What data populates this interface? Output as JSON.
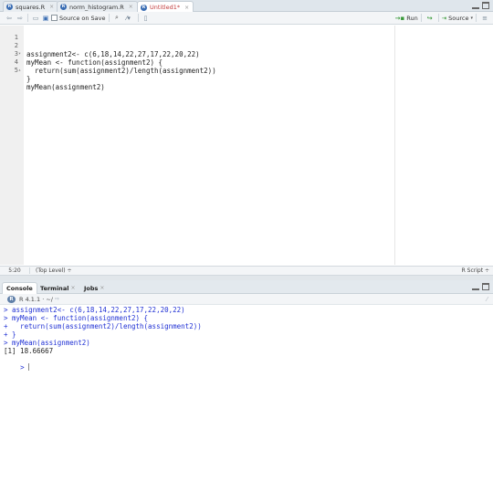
{
  "editor_tabs": [
    {
      "label": "squares.R",
      "close": "×"
    },
    {
      "label": "norm_histogram.R",
      "close": "×"
    },
    {
      "label": "Untitled1*",
      "close": "×"
    }
  ],
  "toolbar": {
    "source_on_save": "Source on Save",
    "run": "Run",
    "source": "Source"
  },
  "code_lines": [
    {
      "num": "1",
      "fold": "",
      "text": "assignment2<- c(6,18,14,22,27,17,22,20,22)"
    },
    {
      "num": "2",
      "fold": "▾",
      "text": "myMean <- function(assignment2) {"
    },
    {
      "num": "3",
      "fold": "",
      "text": "  return(sum(assignment2)/length(assignment2))"
    },
    {
      "num": "4",
      "fold": "▴",
      "text": "}"
    },
    {
      "num": "5",
      "fold": "",
      "text": "myMean(assignment2)"
    }
  ],
  "editor_status": {
    "cursor": "5:20",
    "scope": "(Top Level) ÷",
    "filetype": "R Script ÷"
  },
  "console_tabs": [
    {
      "label": "Console",
      "close": ""
    },
    {
      "label": "Terminal",
      "close": "×"
    },
    {
      "label": "Jobs",
      "close": "×"
    }
  ],
  "console_info": {
    "version": "R 4.1.1 · ~/"
  },
  "console_lines": [
    {
      "text": "> assignment2<- c(6,18,14,22,27,17,22,20,22)",
      "kind": "cmd"
    },
    {
      "text": "> myMean <- function(assignment2) {",
      "kind": "cmd"
    },
    {
      "text": "+   return(sum(assignment2)/length(assignment2))",
      "kind": "cmd"
    },
    {
      "text": "+ }",
      "kind": "cmd"
    },
    {
      "text": "> myMean(assignment2)",
      "kind": "cmd"
    },
    {
      "text": "[1] 18.66667",
      "kind": "out"
    }
  ],
  "console_prompt": ">",
  "colors": {
    "command_blue": "#1f30d4",
    "active_tab_red": "#c23a3a",
    "run_green": "#3a9a3a"
  }
}
